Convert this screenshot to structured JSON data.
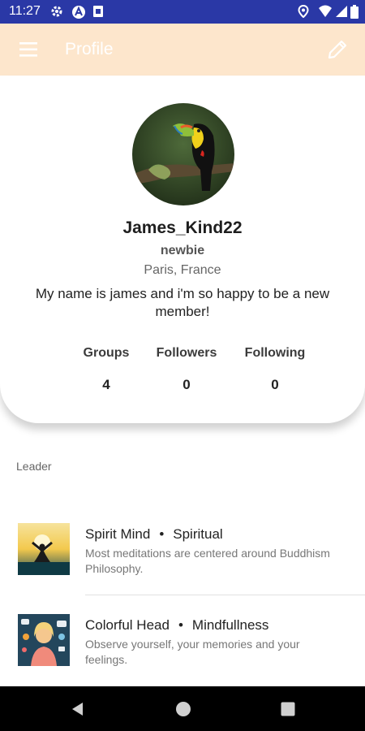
{
  "status_bar": {
    "time": "11:27"
  },
  "app_bar": {
    "title": "Profile"
  },
  "profile": {
    "username": "James_Kind22",
    "rank": "newbie",
    "location": "Paris, France",
    "bio": "My name is james and i'm so happy to be a new member!"
  },
  "stats": [
    {
      "label": "Groups",
      "value": "4"
    },
    {
      "label": "Followers",
      "value": "0"
    },
    {
      "label": "Following",
      "value": "0"
    }
  ],
  "section": {
    "label": "Leader"
  },
  "groups": [
    {
      "name": "Spirit Mind",
      "separator": "•",
      "category": "Spiritual",
      "description": "Most meditations are centered around Buddhism Philosophy."
    },
    {
      "name": "Colorful Head",
      "separator": "•",
      "category": "Mindfullness",
      "description": "Observe yourself, your memories and your feelings."
    }
  ],
  "colors": {
    "status_bar": "#2a38a6",
    "app_bar": "#fde6cc",
    "nav_bar": "#000000"
  }
}
